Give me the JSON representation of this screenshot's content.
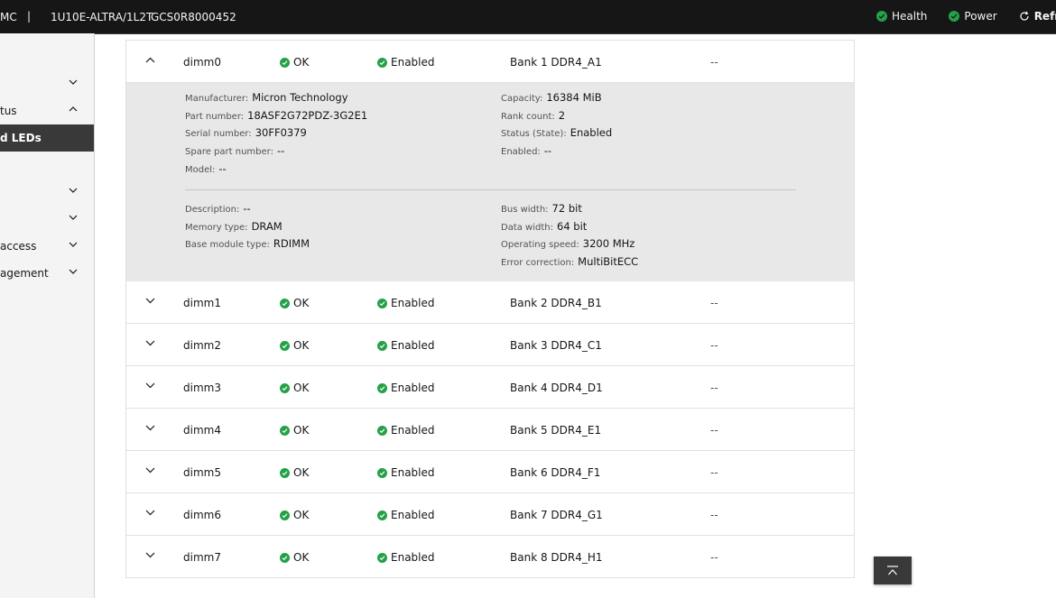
{
  "header": {
    "brand": "MC",
    "separator": "|",
    "server_name": "1U10E-ALTRA/1L2T",
    "serial": "GCS0R8000452",
    "health_label": "Health",
    "power_label": "Power",
    "refresh_label": "Refresh"
  },
  "sidebar": {
    "items": [
      {
        "label": ""
      },
      {
        "label": "tus"
      },
      {
        "label": "d LEDs"
      },
      {
        "label": ""
      },
      {
        "label": ""
      },
      {
        "label": "access"
      },
      {
        "label": "agement"
      }
    ]
  },
  "dimms": [
    {
      "name": "dimm0",
      "status": "OK",
      "state": "Enabled",
      "location": "Bank 1 DDR4_A1",
      "extra": "--"
    },
    {
      "name": "dimm1",
      "status": "OK",
      "state": "Enabled",
      "location": "Bank 2 DDR4_B1",
      "extra": "--"
    },
    {
      "name": "dimm2",
      "status": "OK",
      "state": "Enabled",
      "location": "Bank 3 DDR4_C1",
      "extra": "--"
    },
    {
      "name": "dimm3",
      "status": "OK",
      "state": "Enabled",
      "location": "Bank 4 DDR4_D1",
      "extra": "--"
    },
    {
      "name": "dimm4",
      "status": "OK",
      "state": "Enabled",
      "location": "Bank 5 DDR4_E1",
      "extra": "--"
    },
    {
      "name": "dimm5",
      "status": "OK",
      "state": "Enabled",
      "location": "Bank 6 DDR4_F1",
      "extra": "--"
    },
    {
      "name": "dimm6",
      "status": "OK",
      "state": "Enabled",
      "location": "Bank 7 DDR4_G1",
      "extra": "--"
    },
    {
      "name": "dimm7",
      "status": "OK",
      "state": "Enabled",
      "location": "Bank 8 DDR4_H1",
      "extra": "--"
    }
  ],
  "details": {
    "manufacturer_label": "Manufacturer:",
    "manufacturer": "Micron Technology",
    "part_label": "Part number:",
    "part": "18ASF2G72PDZ-3G2E1",
    "serial_label": "Serial number:",
    "serial": "30FF0379",
    "spare_label": "Spare part number:",
    "spare": "--",
    "model_label": "Model:",
    "model": "--",
    "capacity_label": "Capacity:",
    "capacity": "16384 MiB",
    "rank_label": "Rank count:",
    "rank": "2",
    "status_label": "Status (State):",
    "status": "Enabled",
    "enabled_label": "Enabled:",
    "enabled": "--",
    "description_label": "Description:",
    "description": "--",
    "memtype_label": "Memory type:",
    "memtype": "DRAM",
    "basemodule_label": "Base module type:",
    "basemodule": "RDIMM",
    "buswidth_label": "Bus width:",
    "buswidth": "72 bit",
    "datawidth_label": "Data width:",
    "datawidth": "64 bit",
    "speed_label": "Operating speed:",
    "speed": "3200 MHz",
    "ecc_label": "Error correction:",
    "ecc": "MultiBitECC"
  },
  "colors": {
    "topbar": "#161616",
    "ok_green": "#24a148",
    "active_nav": "#393939"
  },
  "icons": {
    "health": "check-circle-icon",
    "power": "check-circle-icon",
    "refresh": "refresh-icon",
    "expand": "chevron-icon",
    "back_to_top": "arrow-up-to-top-icon"
  }
}
